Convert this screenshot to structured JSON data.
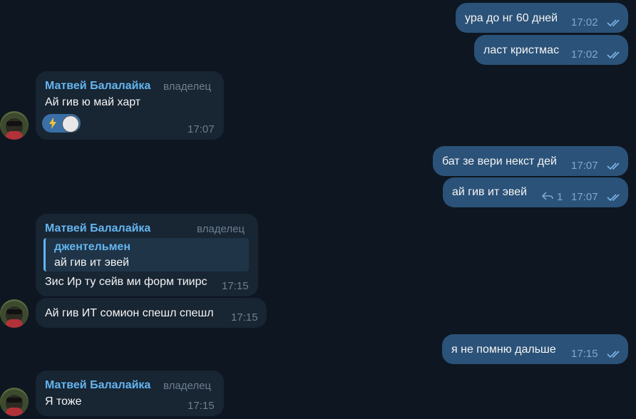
{
  "colors": {
    "background": "#0e1621",
    "outgoing": "#2b5278",
    "incoming": "#182533",
    "accent": "#64b5ef"
  },
  "messages": [
    {
      "direction": "out",
      "text": "ура до нг 60 дней",
      "time": "17:02",
      "status": "read"
    },
    {
      "direction": "out",
      "text": "ласт кристмас",
      "time": "17:02",
      "status": "read"
    },
    {
      "direction": "in",
      "sender": "Матвей Балалайка",
      "role": "владелец",
      "text": "Ай гив ю май харт",
      "time": "17:07",
      "reactions": {
        "emoji_icon": "lightning-icon",
        "avatar_icon": "reactor-avatar-icon"
      }
    },
    {
      "direction": "out",
      "text": "бат зе вери некст дей",
      "time": "17:07",
      "status": "read"
    },
    {
      "direction": "out",
      "text": "ай гив ит эвей",
      "time": "17:07",
      "status": "read",
      "replies": "1"
    },
    {
      "direction": "in",
      "sender": "Матвей Балалайка",
      "role": "владелец",
      "quote": {
        "author": "джентельмен",
        "text": "ай гив ит эвей"
      },
      "text": "Зис Ир ту сейв ми форм тиирс",
      "time": "17:15"
    },
    {
      "direction": "in",
      "text": "Ай гив ИТ сомион спешл спешл",
      "time": "17:15"
    },
    {
      "direction": "out",
      "text": "я не помню дальше",
      "time": "17:15",
      "status": "read"
    },
    {
      "direction": "in",
      "sender": "Матвей Балалайка",
      "role": "владелец",
      "text": "Я тоже",
      "time": "17:15"
    }
  ]
}
